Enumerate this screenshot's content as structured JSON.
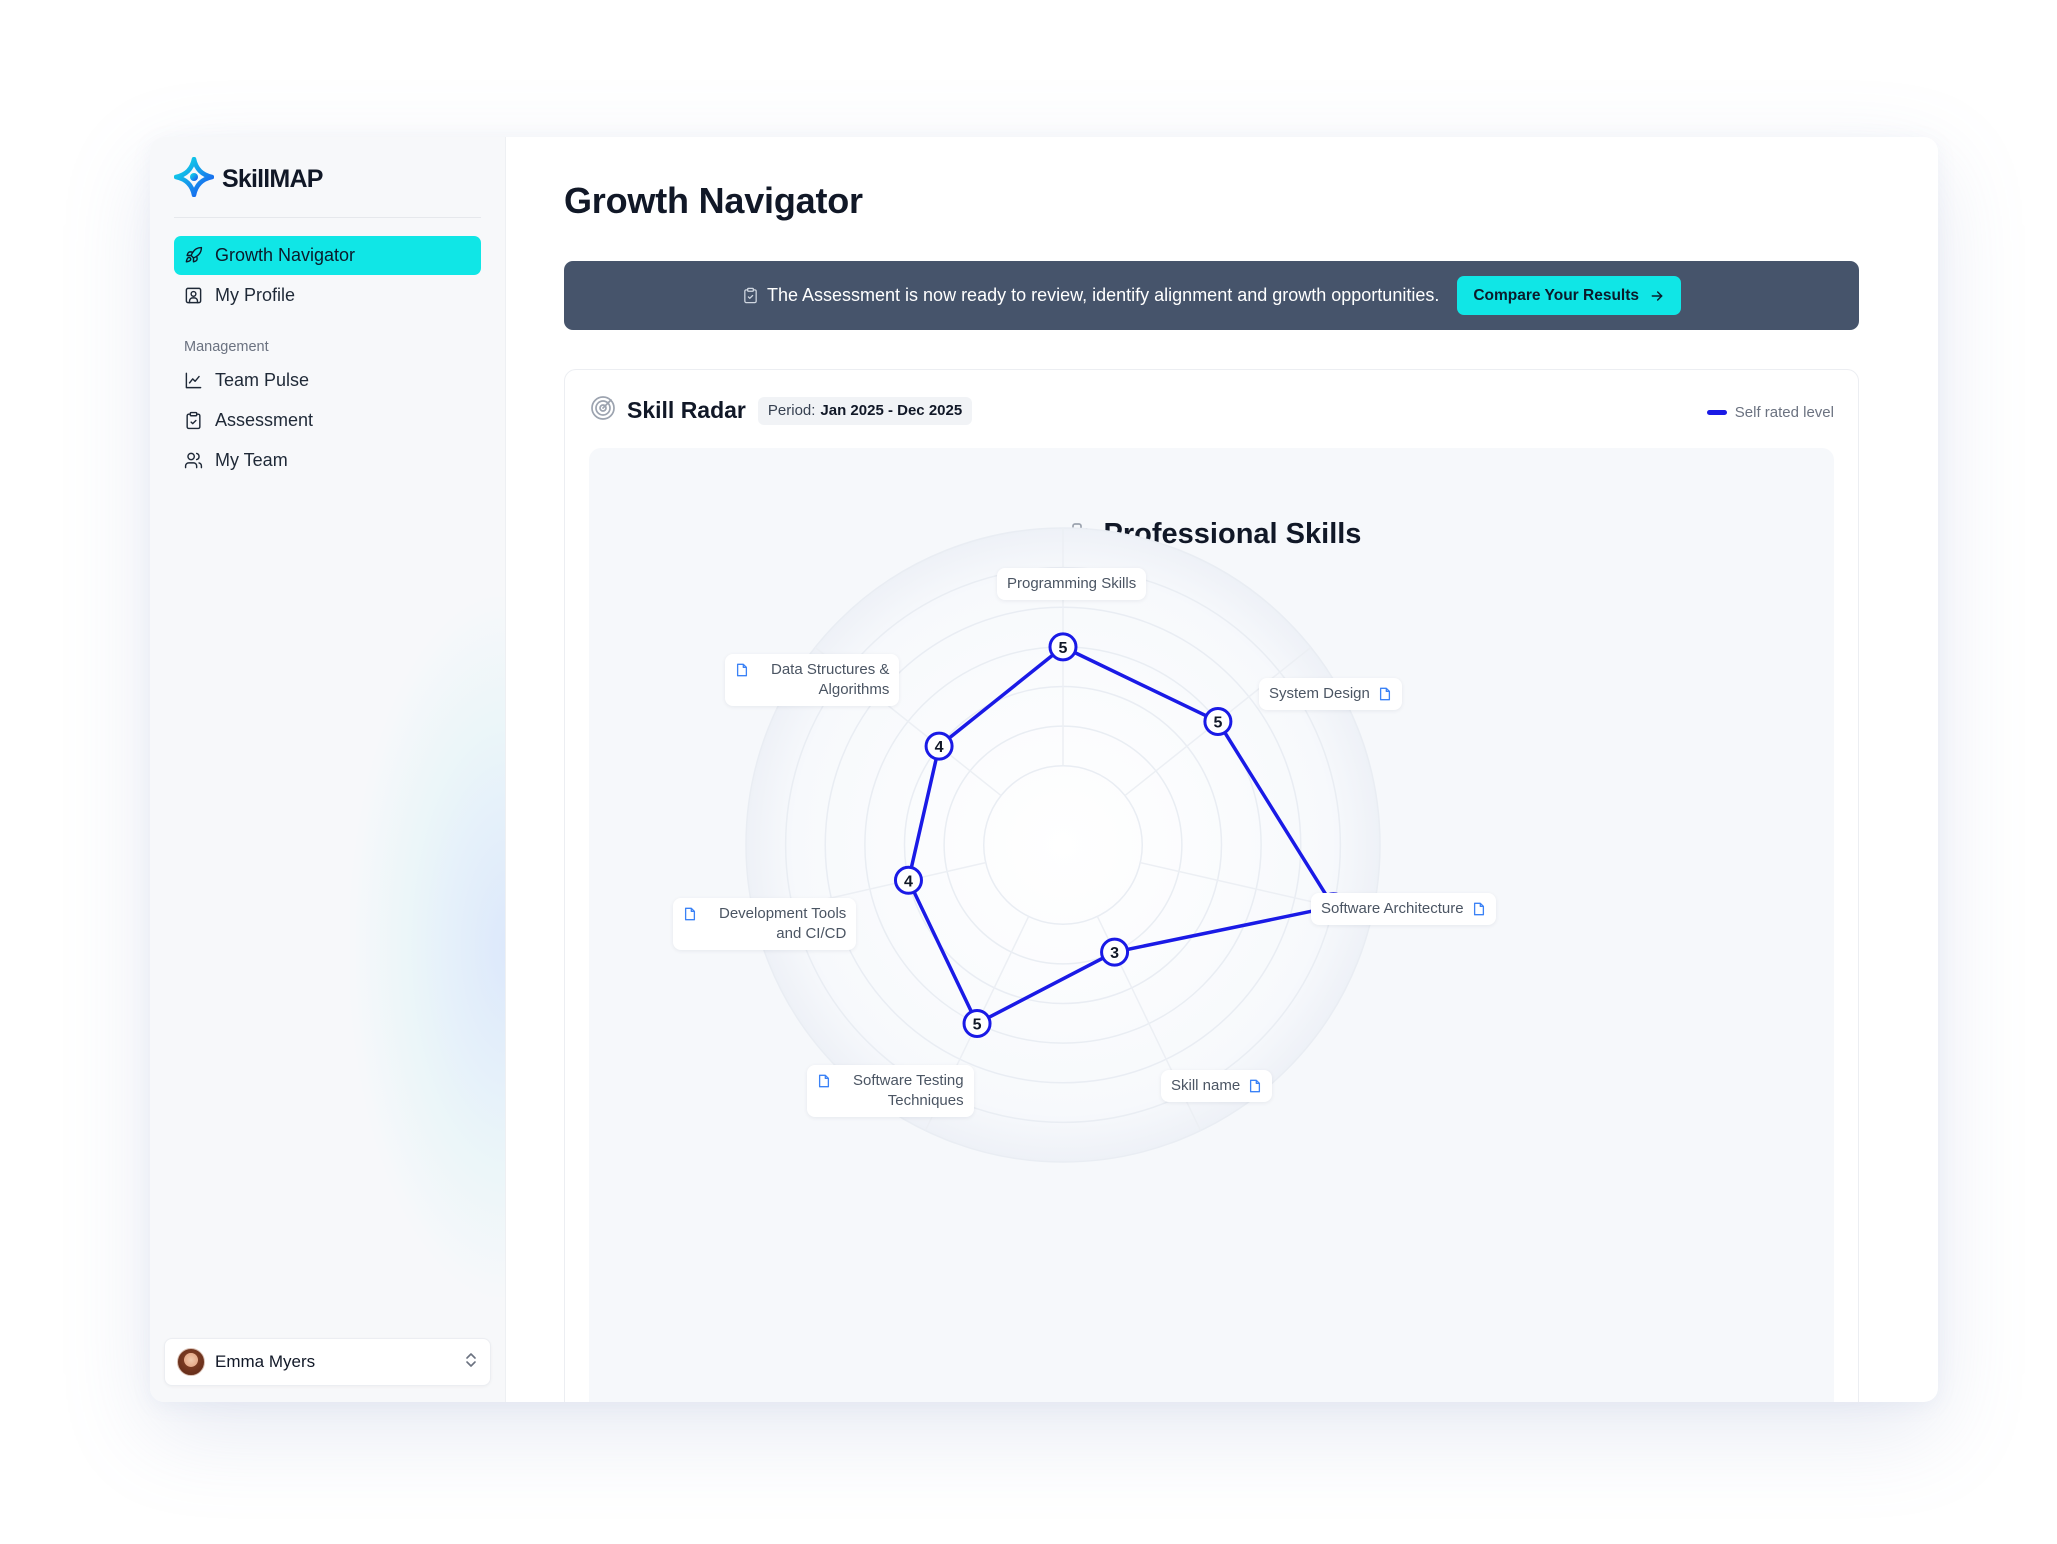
{
  "app": {
    "name": "SkillMAP"
  },
  "sidebar": {
    "nav": [
      {
        "label": "Growth Navigator",
        "icon": "rocket-icon",
        "active": true
      },
      {
        "label": "My Profile",
        "icon": "profile-icon",
        "active": false
      }
    ],
    "section_label": "Management",
    "management": [
      {
        "label": "Team Pulse",
        "icon": "line-chart-icon"
      },
      {
        "label": "Assessment",
        "icon": "clipboard-check-icon"
      },
      {
        "label": "My Team",
        "icon": "users-icon"
      }
    ],
    "user": {
      "name": "Emma Myers"
    }
  },
  "page": {
    "title": "Growth Navigator"
  },
  "banner": {
    "message": "The Assessment is now ready to review, identify alignment and growth opportunities.",
    "cta_label": "Compare Your Results",
    "background": "#46546b",
    "accent": "#10e6e6"
  },
  "card": {
    "title": "Skill Radar",
    "period_label": "Period:",
    "period_value": "Jan 2025 - Dec 2025",
    "legend_label": "Self rated level"
  },
  "chart_data": {
    "type": "radar",
    "title": "Professional Skills",
    "max": 8,
    "rings": 8,
    "series_color": "#1a1ae6",
    "categories": [
      "Programming Skills",
      "System Design",
      "Software Architecture",
      "Skill name",
      "Software Testing Techniques",
      "Development Tools and CI/CD",
      "Data Structures & Algorithms"
    ],
    "series": [
      {
        "name": "Self rated level",
        "values": [
          5,
          5,
          7,
          3,
          5,
          4,
          4
        ]
      }
    ]
  }
}
